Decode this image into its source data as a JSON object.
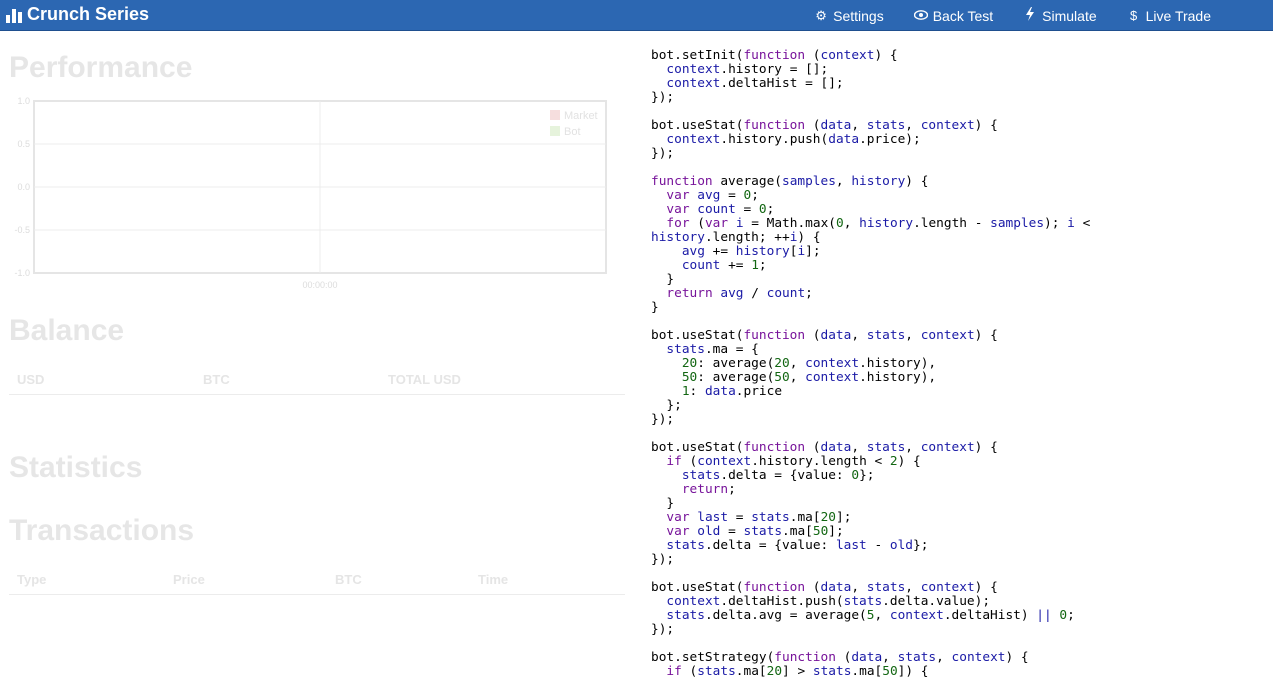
{
  "nav": {
    "brand": "Crunch Series",
    "items": [
      {
        "label": "Settings",
        "icon": "gear-icon"
      },
      {
        "label": "Back Test",
        "icon": "eye-icon"
      },
      {
        "label": "Simulate",
        "icon": "bolt-icon"
      },
      {
        "label": "Live Trade",
        "icon": "dollar-icon"
      }
    ]
  },
  "performance": {
    "title": "Performance",
    "chart_data": {
      "type": "line",
      "title": "",
      "xlabel": "",
      "ylabel": "",
      "x": [
        "00:00:00"
      ],
      "yticks": [
        "1.0",
        "0.5",
        "0.0",
        "-0.5",
        "-1.0"
      ],
      "ylim": [
        -1.0,
        1.0
      ],
      "series": [
        {
          "name": "Market",
          "color": "#f6dede",
          "values": []
        },
        {
          "name": "Bot",
          "color": "#e6f3dc",
          "values": []
        }
      ],
      "grid": true,
      "legend": "top-right"
    }
  },
  "balance": {
    "title": "Balance",
    "columns": [
      "USD",
      "BTC",
      "TOTAL USD"
    ]
  },
  "statistics": {
    "title": "Statistics"
  },
  "transactions": {
    "title": "Transactions",
    "columns": [
      "Type",
      "Price",
      "BTC",
      "Time"
    ]
  },
  "code_lines": [
    "bot.setInit(function (context) {",
    "  context.history = [];",
    "  context.deltaHist = [];",
    "});",
    "",
    "bot.useStat(function (data, stats, context) {",
    "  context.history.push(data.price);",
    "});",
    "",
    "function average(samples, history) {",
    "  var avg = 0;",
    "  var count = 0;",
    "  for (var i = Math.max(0, history.length - samples); i <",
    "history.length; ++i) {",
    "    avg += history[i];",
    "    count += 1;",
    "  }",
    "  return avg / count;",
    "}",
    "",
    "bot.useStat(function (data, stats, context) {",
    "  stats.ma = {",
    "    20: average(20, context.history),",
    "    50: average(50, context.history),",
    "    1: data.price",
    "  };",
    "});",
    "",
    "bot.useStat(function (data, stats, context) {",
    "  if (context.history.length < 2) {",
    "    stats.delta = {value: 0};",
    "    return;",
    "  }",
    "  var last = stats.ma[20];",
    "  var old = stats.ma[50];",
    "  stats.delta = {value: last - old};",
    "});",
    "",
    "bot.useStat(function (data, stats, context) {",
    "  context.deltaHist.push(stats.delta.value);",
    "  stats.delta.avg = average(5, context.deltaHist) || 0;",
    "});",
    "",
    "bot.setStrategy(function (data, stats, context) {",
    "  if (stats.ma[20] > stats.ma[50]) {"
  ]
}
